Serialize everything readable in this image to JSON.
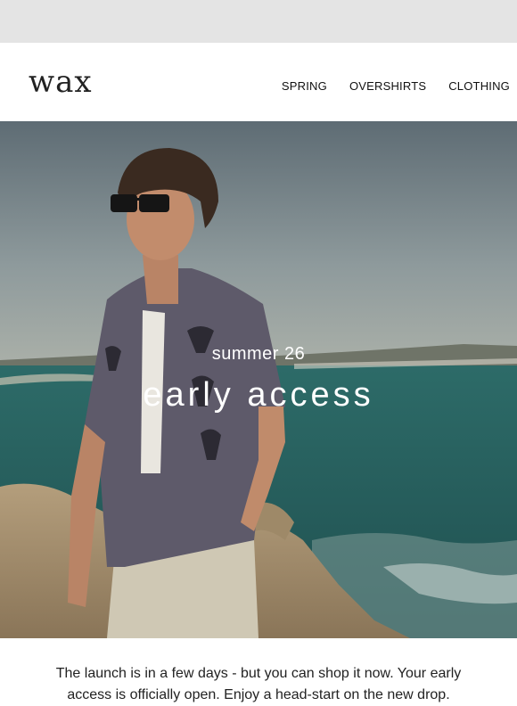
{
  "brand": {
    "logo": "wax"
  },
  "nav": {
    "items": [
      "SPRING",
      "OVERSHIRTS",
      "CLOTHING"
    ]
  },
  "hero": {
    "subtitle": "summer 26",
    "title": "early access"
  },
  "body": {
    "text": "The launch is in a few days - but you can shop it now. Your early access is officially open. Enjoy a head-start on the new drop."
  },
  "colors": {
    "topbar": "#e4e4e4",
    "text": "#222222",
    "sea": "#2f6d6a"
  }
}
